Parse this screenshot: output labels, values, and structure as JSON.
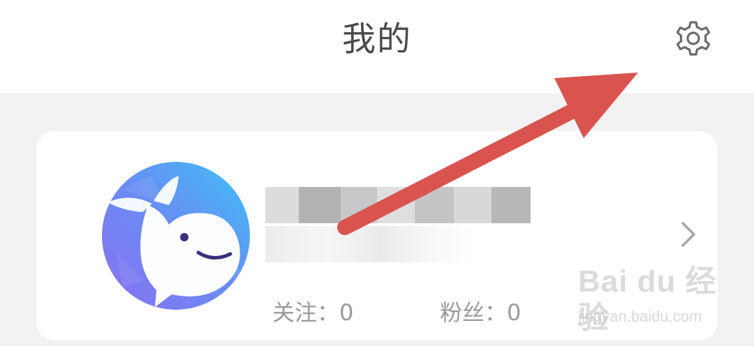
{
  "header": {
    "title": "我的",
    "settings_icon": "gear-icon"
  },
  "profile": {
    "avatar_icon": "whale-avatar",
    "stats": {
      "follow_label": "关注：",
      "follow_count": "0",
      "fans_label": "粉丝：",
      "fans_count": "0"
    },
    "chevron_icon": "chevron-right-icon"
  },
  "annotation": {
    "arrow_color": "#d9534f"
  },
  "watermark": {
    "brand_text": "Bai du 经验",
    "url_text": "jingyan.baidu.com"
  },
  "colors": {
    "background": "#f2f2f2",
    "card": "#ffffff",
    "title_text": "#4a4a4a",
    "stat_text": "#9a9a9a",
    "avatar_gradient_start": "#7a86f2",
    "avatar_gradient_end": "#4fb3f5"
  }
}
